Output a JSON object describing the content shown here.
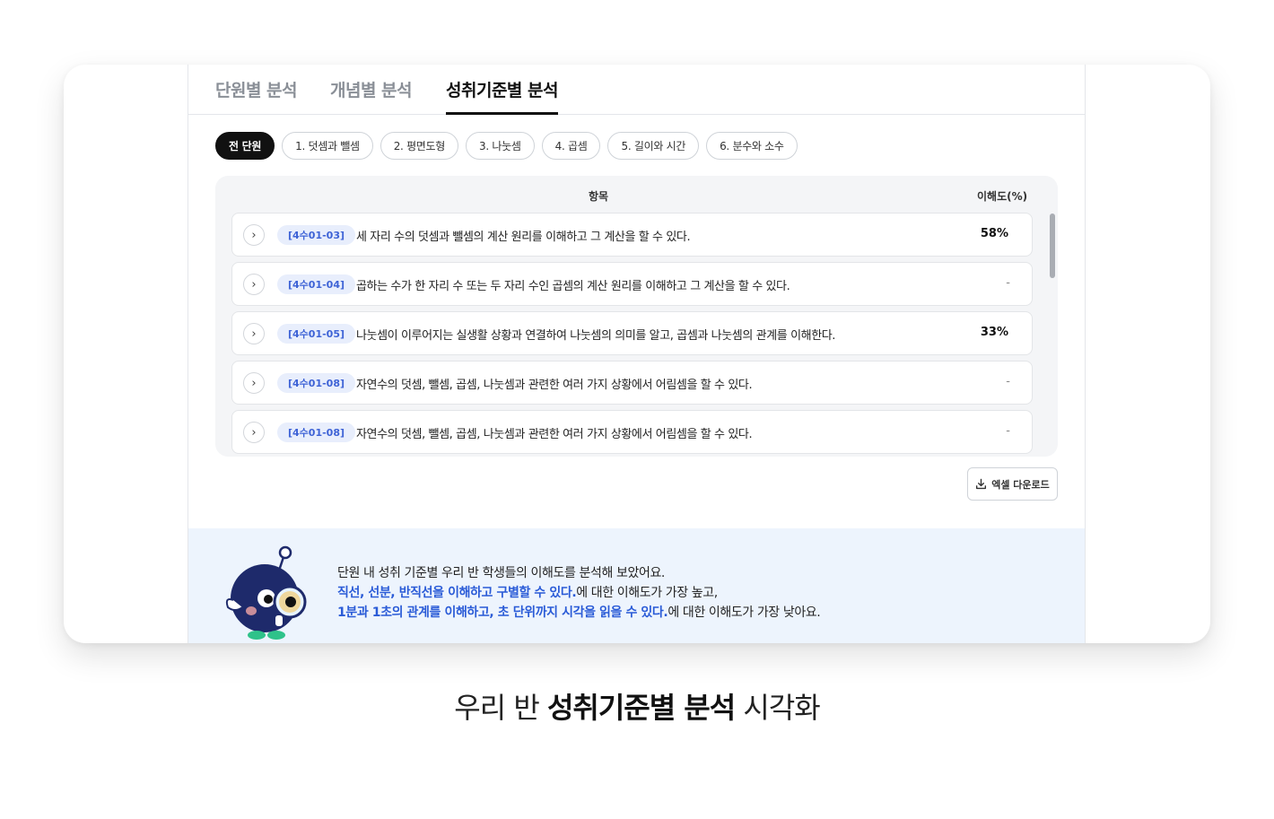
{
  "tabs": [
    {
      "label": "단원별 분석"
    },
    {
      "label": "개념별 분석"
    },
    {
      "label": "성취기준별 분석"
    }
  ],
  "chips": [
    {
      "label": "전 단원"
    },
    {
      "label": "1. 덧셈과 뺄셈"
    },
    {
      "label": "2. 평면도형"
    },
    {
      "label": "3. 나눗셈"
    },
    {
      "label": "4. 곱셈"
    },
    {
      "label": "5. 길이와 시간"
    },
    {
      "label": "6. 분수와 소수"
    }
  ],
  "table": {
    "header_item": "항목",
    "header_rate": "이해도(%)",
    "rows": [
      {
        "code": "[4수01-03]",
        "desc": "세 자리 수의 덧셈과 뺄셈의 계산 원리를 이해하고 그 계산을 할 수 있다.",
        "rate": "58%"
      },
      {
        "code": "[4수01-04]",
        "desc": "곱하는 수가 한 자리 수 또는 두 자리 수인 곱셈의 계산 원리를 이해하고 그 계산을 할 수 있다.",
        "rate": "-"
      },
      {
        "code": "[4수01-05]",
        "desc": "나눗셈이 이루어지는 실생활 상황과 연결하여 나눗셈의 의미를 알고, 곱셈과 나눗셈의 관계를 이해한다.",
        "rate": "33%"
      },
      {
        "code": "[4수01-08]",
        "desc": "자연수의 덧셈, 뺄셈, 곱셈, 나눗셈과 관련한 여러 가지 상황에서 어림셈을 할 수 있다.",
        "rate": "-"
      },
      {
        "code": "[4수01-08]",
        "desc": "자연수의 덧셈, 뺄셈, 곱셈, 나눗셈과 관련한 여러 가지 상황에서 어림셈을 할 수 있다.",
        "rate": "-"
      }
    ]
  },
  "download_label": "엑셀 다운로드",
  "info": {
    "line1": "단원 내 성취 기준별 우리 반 학생들의 이해도를 분석해 보았어요.",
    "line2_highlight": "직선, 선분, 반직선을 이해하고 구별할 수 있다.",
    "line2_rest": "에 대한 이해도가 가장 높고,",
    "line3_highlight": "1분과 1초의 관계를 이해하고, 초 단위까지 시각을 읽을 수 있다.",
    "line3_rest": "에 대한 이해도가 가장 낮아요."
  },
  "caption": {
    "pre": "우리 반 ",
    "bold": "성취기준별 분석",
    "post": " 시각화"
  },
  "colors": {
    "accent": "#2a5bd7",
    "code_bg": "#e8eefc",
    "info_bg": "#edf4fd",
    "mascot_body": "#1e2a6b"
  },
  "icons": [
    "chevron-right-icon",
    "download-icon",
    "mascot-magnifier"
  ]
}
